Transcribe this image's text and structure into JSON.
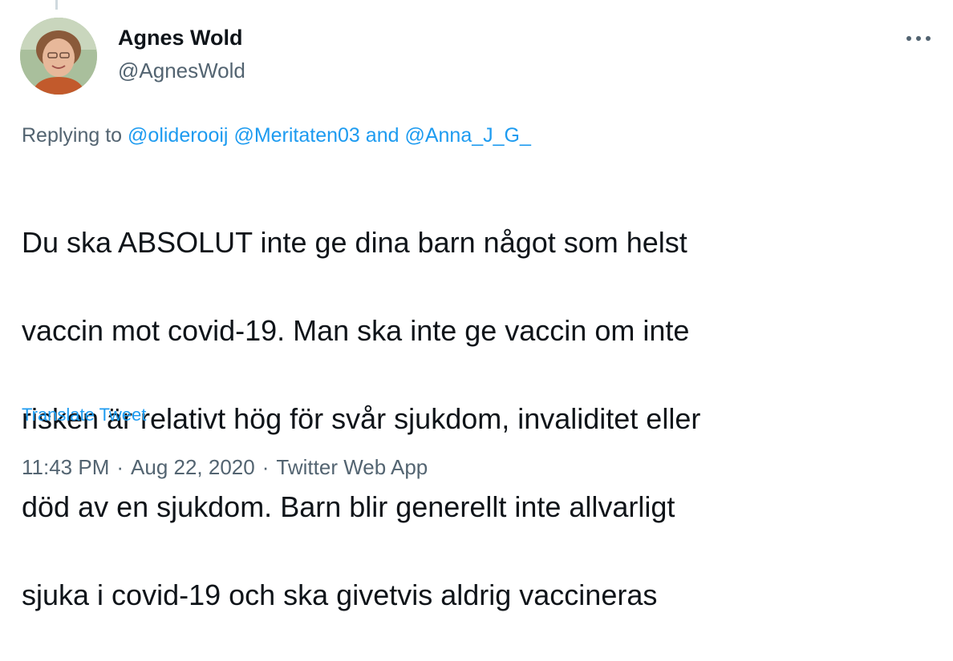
{
  "tweet": {
    "author": {
      "display_name": "Agnes Wold",
      "handle": "@AgnesWold"
    },
    "replying": {
      "prefix": "Replying to",
      "mentions": [
        "@oliderooij",
        "@Meritaten03",
        "@Anna_J_G_"
      ],
      "conjunction": "and"
    },
    "text_lines": [
      "Du ska ABSOLUT inte ge dina barn något som helst",
      "vaccin mot covid-19. Man ska inte ge vaccin om inte",
      "risken är relativt hög för svår sjukdom, invaliditet eller",
      "död av en sjukdom. Barn blir generellt inte allvarligt",
      "sjuka i covid-19 och ska givetvis aldrig vaccineras"
    ],
    "translate_label": "Translate Tweet",
    "time": "11:43 PM",
    "date": "Aug 22, 2020",
    "source": "Twitter Web App",
    "separator": "·"
  },
  "icons": {
    "more": "more-horizontal-icon"
  },
  "colors": {
    "link": "#1d9bf0",
    "secondary_text": "#536471",
    "primary_text": "#0f1419"
  }
}
